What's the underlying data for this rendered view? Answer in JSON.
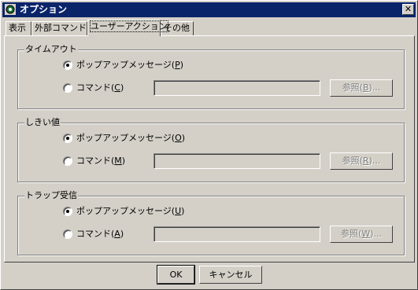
{
  "window": {
    "title": "オプション"
  },
  "tabs": [
    {
      "label": "表示"
    },
    {
      "label": "外部コマンド"
    },
    {
      "label": "ユーザーアクション"
    },
    {
      "label": "その他"
    }
  ],
  "groups": [
    {
      "title": "タイムアウト",
      "popup_label": "ポップアップメッセージ(",
      "popup_key": "P",
      "popup_tail": ")",
      "command_label": "コマンド(",
      "command_key": "C",
      "command_tail": ")",
      "command_value": "",
      "browse_label": "参照(",
      "browse_key": "B",
      "browse_tail": ")...",
      "selected": "popup"
    },
    {
      "title": "しきい値",
      "popup_label": "ポップアップメッセージ(",
      "popup_key": "O",
      "popup_tail": ")",
      "command_label": "コマンド(",
      "command_key": "M",
      "command_tail": ")",
      "command_value": "",
      "browse_label": "参照(",
      "browse_key": "R",
      "browse_tail": ")...",
      "selected": "popup"
    },
    {
      "title": "トラップ受信",
      "popup_label": "ポップアップメッセージ(",
      "popup_key": "U",
      "popup_tail": ")",
      "command_label": "コマンド(",
      "command_key": "A",
      "command_tail": ")",
      "command_value": "",
      "browse_label": "参照(",
      "browse_key": "W",
      "browse_tail": ")...",
      "selected": "popup"
    }
  ],
  "buttons": {
    "ok": "OK",
    "cancel": "キャンセル"
  }
}
